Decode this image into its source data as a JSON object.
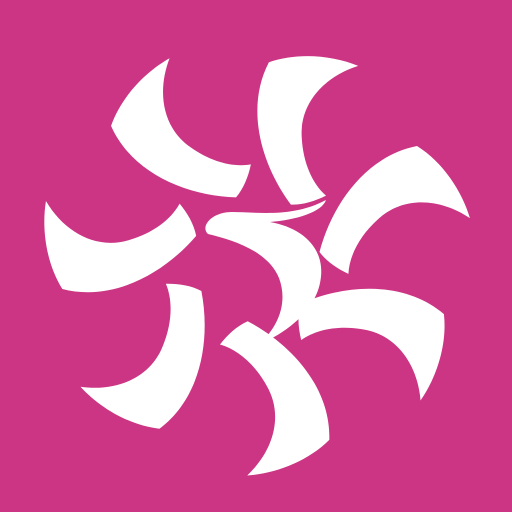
{
  "icon": {
    "name": "swirl-flower-logo-icon",
    "background_color": "#CB3583",
    "foreground_color": "#FFFFFF",
    "petal_count": 7
  }
}
